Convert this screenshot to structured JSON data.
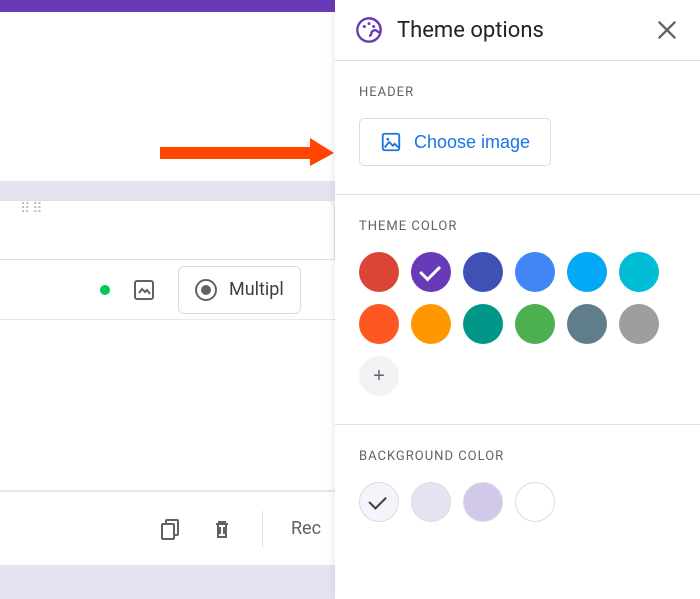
{
  "panel": {
    "title": "Theme options",
    "sections": {
      "header": {
        "label": "HEADER",
        "button": "Choose image"
      },
      "theme_color": {
        "label": "THEME COLOR",
        "colors": [
          {
            "hex": "#db4437",
            "selected": false
          },
          {
            "hex": "#673ab7",
            "selected": true
          },
          {
            "hex": "#3f51b5",
            "selected": false
          },
          {
            "hex": "#4285f4",
            "selected": false
          },
          {
            "hex": "#03a9f4",
            "selected": false
          },
          {
            "hex": "#00bcd4",
            "selected": false
          },
          {
            "hex": "#ff5722",
            "selected": false
          },
          {
            "hex": "#ff9800",
            "selected": false
          },
          {
            "hex": "#009688",
            "selected": false
          },
          {
            "hex": "#4caf50",
            "selected": false
          },
          {
            "hex": "#607d8b",
            "selected": false
          },
          {
            "hex": "#9e9e9e",
            "selected": false
          }
        ]
      },
      "background_color": {
        "label": "BACKGROUND COLOR",
        "colors": [
          {
            "hex": "#f6f3fb",
            "selected": true
          },
          {
            "hex": "#e8e3f4",
            "selected": false
          },
          {
            "hex": "#d2c8ea",
            "selected": false
          },
          {
            "hex": "#ffffff",
            "selected": false
          }
        ]
      }
    }
  },
  "editor": {
    "question_type": "Multipl",
    "bottom_action": "Rec"
  }
}
